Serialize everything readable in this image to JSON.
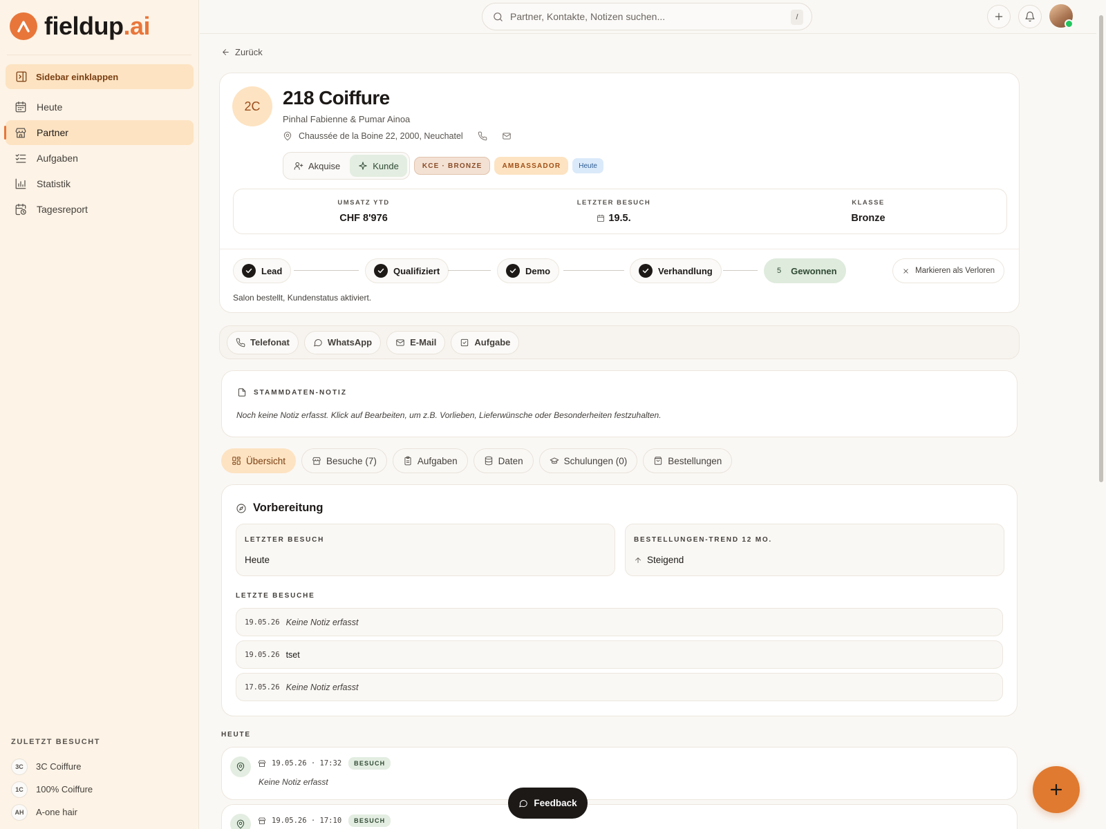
{
  "brand": {
    "name": "fieldup",
    "suffix": ".ai",
    "color": "#e8763a"
  },
  "sidebar": {
    "collapse_label": "Sidebar einklappen",
    "nav": [
      {
        "label": "Heute",
        "icon": "calendar-icon"
      },
      {
        "label": "Partner",
        "icon": "store-icon",
        "active": true
      },
      {
        "label": "Aufgaben",
        "icon": "list-checks-icon"
      },
      {
        "label": "Statistik",
        "icon": "bar-chart-icon"
      },
      {
        "label": "Tagesreport",
        "icon": "calendar-clock-icon"
      }
    ],
    "recent_title": "ZULETZT BESUCHT",
    "recent": [
      {
        "abbr": "3C",
        "name": "3C Coiffure"
      },
      {
        "abbr": "1C",
        "name": "100% Coiffure"
      },
      {
        "abbr": "AH",
        "name": "A-one hair"
      }
    ]
  },
  "topbar": {
    "search_placeholder": "Partner, Kontakte, Notizen suchen...",
    "shortcut": "/"
  },
  "back_label": "Zurück",
  "partner": {
    "initials": "2C",
    "name": "218 Coiffure",
    "contacts": "Pinhal Fabienne & Pumar Ainoa",
    "address": "Chaussée de la Boine 22, 2000, Neuchatel",
    "segments": {
      "acquisition": "Akquise",
      "customer": "Kunde"
    },
    "badges": {
      "class": "KCE · BRONZE",
      "ambassador": "AMBASSADOR",
      "today": "Heute"
    },
    "stats": [
      {
        "label": "UMSATZ YTD",
        "value": "CHF 8'976"
      },
      {
        "label": "LETZTER BESUCH",
        "value": "19.5."
      },
      {
        "label": "KLASSE",
        "value": "Bronze"
      }
    ],
    "pipeline": [
      {
        "label": "Lead"
      },
      {
        "label": "Qualifiziert"
      },
      {
        "label": "Demo"
      },
      {
        "label": "Verhandlung"
      },
      {
        "label": "Gewonnen",
        "number": "5"
      }
    ],
    "lost_label": "Markieren als Verloren",
    "status_note": "Salon bestellt, Kundenstatus aktiviert."
  },
  "actions": [
    "Telefonat",
    "WhatsApp",
    "E-Mail",
    "Aufgabe"
  ],
  "master_note": {
    "title": "STAMMDATEN-NOTIZ",
    "text": "Noch keine Notiz erfasst. Klick auf Bearbeiten, um z.B. Vorlieben, Lieferwünsche oder Besonderheiten festzuhalten."
  },
  "tabs": [
    "Übersicht",
    "Besuche (7)",
    "Aufgaben",
    "Daten",
    "Schulungen (0)",
    "Bestellungen"
  ],
  "prep": {
    "title": "Vorbereitung",
    "last_visit_label": "LETZTER BESUCH",
    "last_visit_value": "Heute",
    "trend_label": "BESTELLUNGEN-TREND 12 MO.",
    "trend_value": "Steigend",
    "recent_label": "LETZTE BESUCHE",
    "recent_visits": [
      {
        "date": "19.05.26",
        "text": "Keine Notiz erfasst"
      },
      {
        "date": "19.05.26",
        "text": "tset"
      },
      {
        "date": "17.05.26",
        "text": "Keine Notiz erfasst"
      }
    ]
  },
  "timeline": {
    "group_label": "HEUTE",
    "entries": [
      {
        "datetime": "19.05.26 · 17:32",
        "tag": "BESUCH",
        "note": "Keine Notiz erfasst"
      },
      {
        "datetime": "19.05.26 · 17:10",
        "tag": "BESUCH",
        "note": ""
      }
    ]
  },
  "feedback_label": "Feedback"
}
